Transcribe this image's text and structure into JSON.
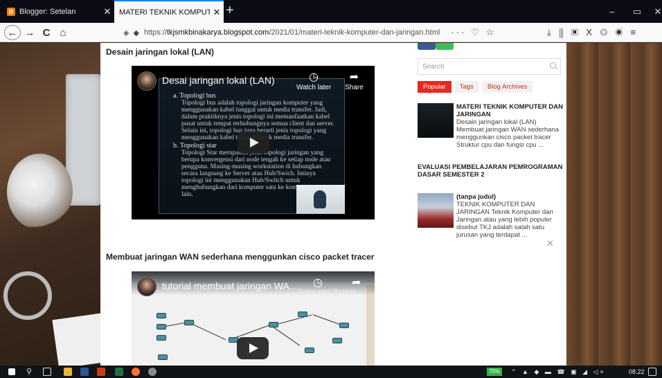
{
  "browser": {
    "tabs": [
      {
        "title": "Blogger: Setelan",
        "close": "✕",
        "active": false
      },
      {
        "title": "MATERI TEKNIK KOMPUTER DAN JARINGAN",
        "close": "✕",
        "active": true
      }
    ],
    "new_tab": "+",
    "window_controls": {
      "minimize": "–",
      "maximize": "▭",
      "close": "✕"
    },
    "nav": {
      "back": "←",
      "forward": "→",
      "reload": "C",
      "home": "⌂"
    },
    "url": {
      "shield": "◈",
      "lock": "🔒",
      "prefix": "https://",
      "domain": "tkjsmkbinakarya.blogspot.com",
      "path": "/2021/01/materi-teknik-komputer-dan-jaringan.html",
      "actions": "··· ♡ ☆"
    },
    "toolbar_icons": "⤓  ⫼  ▣  X  ◎  ◉  ≡"
  },
  "post": {
    "section1_title": "Desain jaringan lokal (LAN)",
    "video1": {
      "title": "Desai jaringan lokal (LAN)",
      "watch_later": "Watch later",
      "share": "Share",
      "slide": {
        "heading_a": "a.  Topologi bus",
        "para_a": "Topologi bus adalah topologi jaringan komputer yang menggunakan kabel tunggal untuk media transfer. Jadi, dalam praktiknya jenis topologi ini memanfaatkan kabel pusat untuk tempat terhubungnya semua client dan server. Selain ini, topologi bus juga berarti jenis topologi yang menggunakan kabel tunggal untuk media transfer.",
        "heading_b": "b.  Topologi star",
        "para_b": "Topologi Star merupakan jenis topologi jaringan yang berupa konvergensi dari node tengah ke setiap node atau pengguna. Masing-masing workstation di hubungkan secara langsung ke Server atau Hub/Swich. Intinya topologi ini menggunakan Hub/Switch untuk menghubungkan dari komputer satu ke komputer yang lain."
      }
    },
    "section2_title": "Membuat jaringan WAN sederhana menggunkan cisco packet tracer",
    "video2": {
      "title": "tutorial membuat jaringan WA...",
      "overlay_text": "Tonton nanti   Bagikan"
    }
  },
  "sidebar": {
    "search_placeholder": "Search",
    "tabs": [
      "Popular",
      "Tags",
      "Blog Archives"
    ],
    "popular": [
      {
        "title": "MATERI TEKNIK KOMPUTER DAN JARINGAN",
        "snippet": "Desain jaringan lokal (LAN) Membuat jaringan WAN sederhana menggunkan cisco packet tracer Struktur cpu dan fungsi cpu ..."
      },
      {
        "title": "EVALUASI PEMBELAJARAN PEMROGRAMAN DASAR SEMESTER 2",
        "snippet": ""
      },
      {
        "title": "(tanpa judul)",
        "snippet": "TEKNIK KOMPUTER DAN JARINGAN    Teknik Komputer dan Jaringan atau yang lebih populer disebut TKJ adalah salah satu jurusan yang terdapat ..."
      }
    ]
  },
  "taskbar": {
    "battery": "75%",
    "time": "08.22",
    "tray": "⌃ ▲ ◆ ▬ ☎ ▣ ◢ ◁×"
  },
  "colors": {
    "accent": "#e6291f",
    "titlebar": "#0c0c17",
    "taskbar": "#101418"
  }
}
